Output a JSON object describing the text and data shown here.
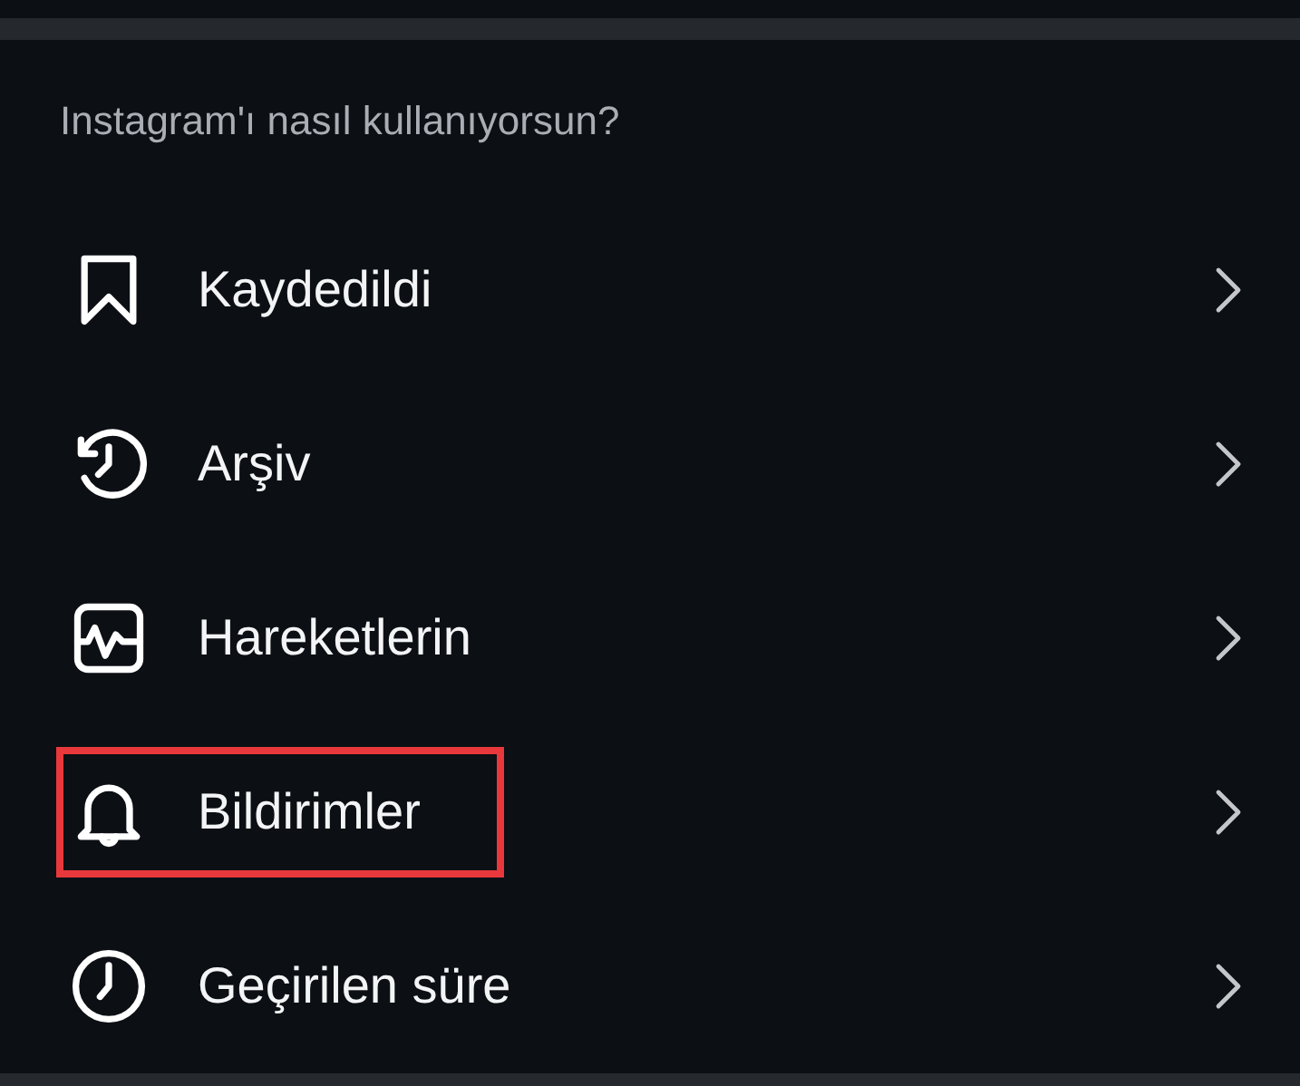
{
  "section": {
    "title": "Instagram'ı nasıl kullanıyorsun?"
  },
  "items": [
    {
      "kind": "bookmark",
      "label": "Kaydedildi",
      "highlighted": false
    },
    {
      "kind": "history",
      "label": "Arşiv",
      "highlighted": false
    },
    {
      "kind": "activity",
      "label": "Hareketlerin",
      "highlighted": false
    },
    {
      "kind": "bell",
      "label": "Bildirimler",
      "highlighted": true
    },
    {
      "kind": "clock",
      "label": "Geçirilen süre",
      "highlighted": false
    }
  ]
}
